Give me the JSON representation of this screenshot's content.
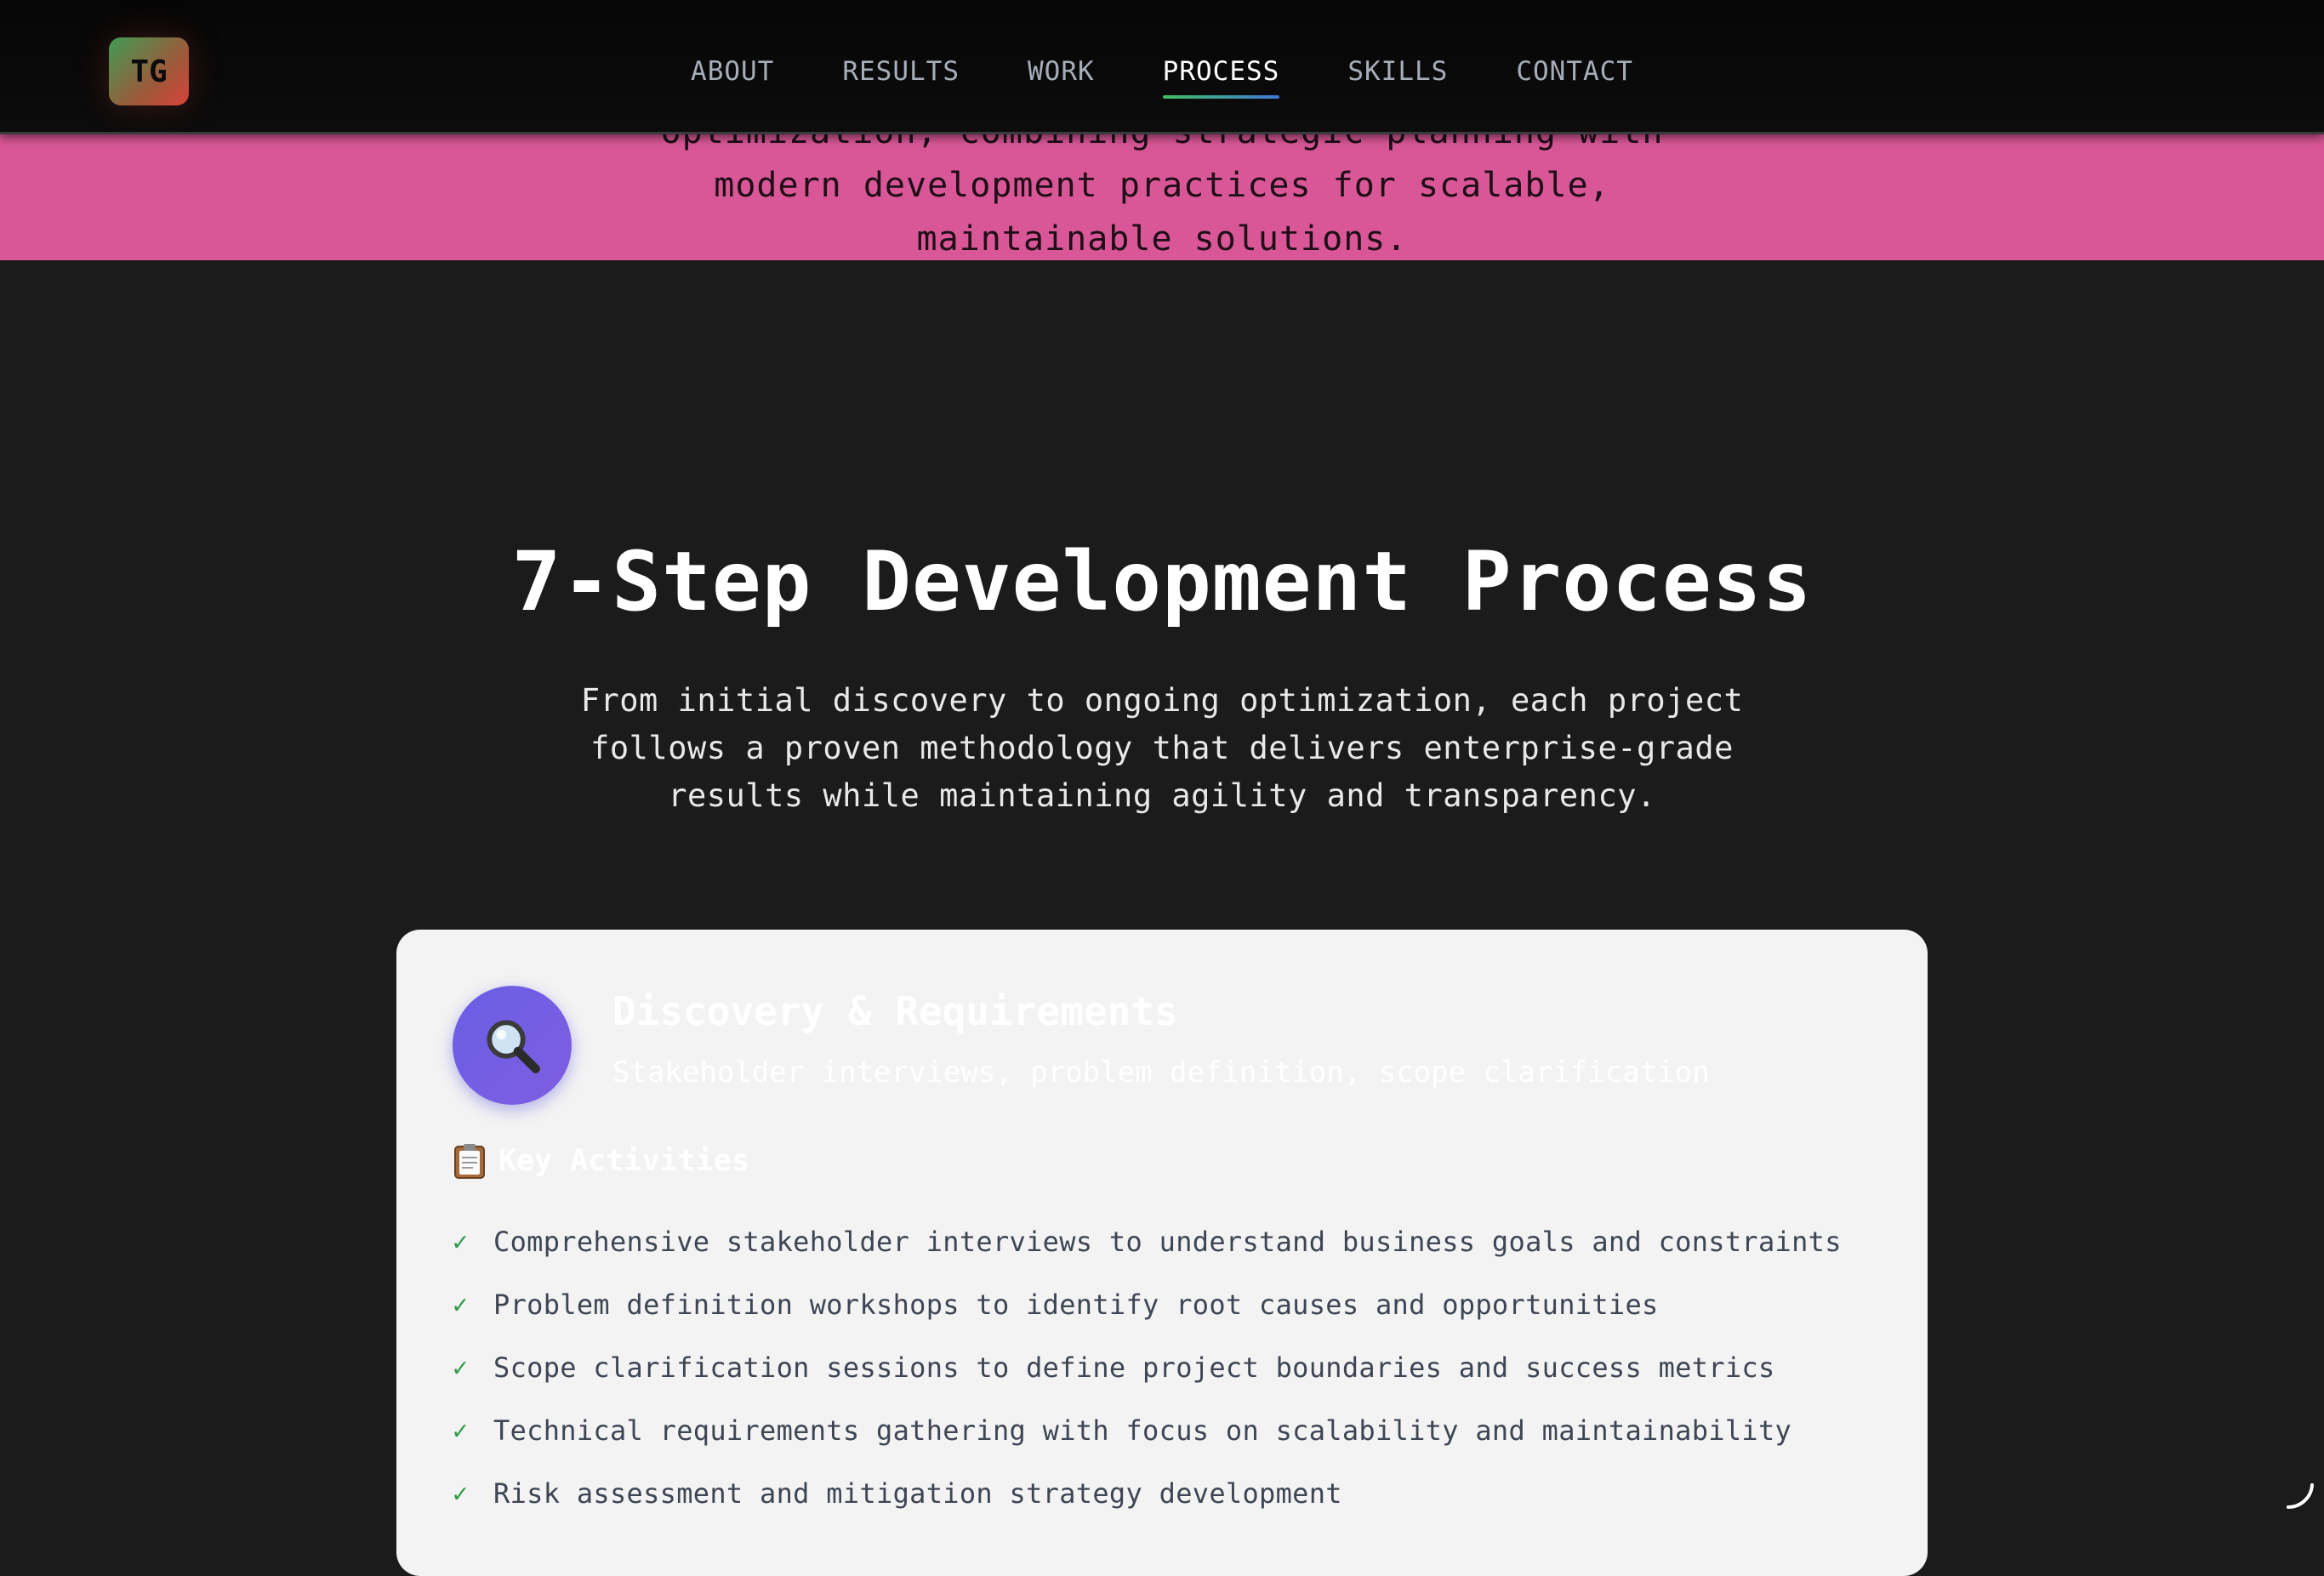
{
  "hero": {
    "text": "optimization, combining strategic planning with\nmodern development practices for scalable,\nmaintainable solutions."
  },
  "navbar": {
    "logo": "TG",
    "links": [
      {
        "label": "ABOUT",
        "active": false
      },
      {
        "label": "RESULTS",
        "active": false
      },
      {
        "label": "WORK",
        "active": false
      },
      {
        "label": "PROCESS",
        "active": true
      },
      {
        "label": "SKILLS",
        "active": false
      },
      {
        "label": "CONTACT",
        "active": false
      }
    ]
  },
  "section": {
    "title": "7-Step Development Process",
    "subtitle": "From initial discovery to ongoing optimization, each project follows a proven methodology that delivers enterprise-grade results while maintaining agility and transparency."
  },
  "step": {
    "icon": "magnifying-glass-icon",
    "title": "Discovery & Requirements",
    "subtitle": "Stakeholder interviews, problem definition, scope clarification",
    "activities_icon": "clipboard-icon",
    "activities_heading": "Key Activities",
    "check_symbol": "✓",
    "activities": [
      "Comprehensive stakeholder interviews to understand business goals and constraints",
      "Problem definition workshops to identify root causes and opportunities",
      "Scope clarification sessions to define project boundaries and success metrics",
      "Technical requirements gathering with focus on scalability and maintainability",
      "Risk assessment and mitigation strategy development"
    ]
  },
  "colors": {
    "hero_background": "#d95796",
    "page_background": "#1b1b1b",
    "card_background": "#f3f3f3",
    "step_icon_gradient": [
      "#6a5fe6",
      "#7f5de0"
    ],
    "check_color": "#2e9a4a",
    "active_underline": [
      "#3fbf62",
      "#3f79d6"
    ]
  }
}
